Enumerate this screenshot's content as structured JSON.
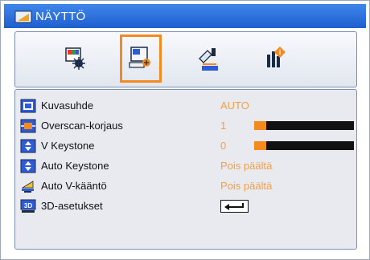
{
  "window": {
    "title": "NÄYTTÖ"
  },
  "tabs": [
    {
      "name": "image-settings",
      "active": false
    },
    {
      "name": "display",
      "active": true
    },
    {
      "name": "setup",
      "active": false
    },
    {
      "name": "options",
      "active": false
    }
  ],
  "menu": [
    {
      "label": "Kuvasuhde",
      "value": "AUTO"
    },
    {
      "label": "Overscan-korjaus",
      "value": "1",
      "level": 0.12
    },
    {
      "label": "V Keystone",
      "value": "0",
      "level": 0.12
    },
    {
      "label": "Auto Keystone",
      "value": "Pois päältä"
    },
    {
      "label": "Auto V-kääntö",
      "value": "Pois päältä"
    },
    {
      "label": "3D-asetukset",
      "value": "",
      "icon_label": "3D"
    }
  ],
  "colors": {
    "accent": "#f28a1e",
    "title_bar": "#2a6de0",
    "value_text": "#f0a04a"
  }
}
